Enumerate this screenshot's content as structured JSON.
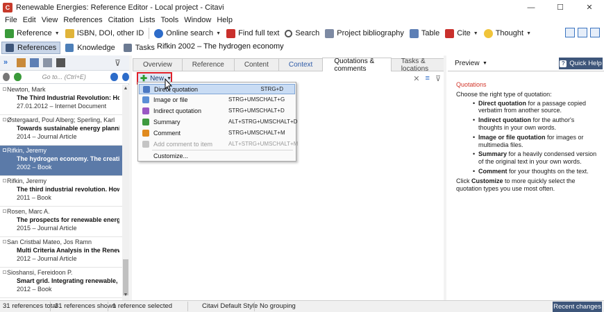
{
  "window": {
    "title": "Renewable Energies: Reference Editor - Local project - Citavi",
    "controls": [
      "—",
      "☐",
      "✕"
    ]
  },
  "menu": [
    "File",
    "Edit",
    "View",
    "References",
    "Citation",
    "Lists",
    "Tools",
    "Window",
    "Help"
  ],
  "toolbar": {
    "reference": "Reference",
    "isbn": "ISBN, DOI, other ID",
    "online_search": "Online search",
    "find_full_text": "Find full text",
    "search": "Search",
    "project_bibliography": "Project bibliography",
    "table": "Table",
    "cite": "Cite",
    "thought": "Thought"
  },
  "nav_tabs": [
    "References",
    "Knowledge",
    "Tasks"
  ],
  "left_panel": {
    "search_placeholder": "Go to... (Ctrl+E)",
    "references": [
      {
        "author": "Newton, Mark",
        "title": "The Third Industrial Revolution: How Lat",
        "meta": "27.01.2012 – Internet Document",
        "selected": false
      },
      {
        "author": "Østergaard, Poul Alberg; Sperling, Karl",
        "title": "Towards sustainable energy planning and",
        "meta": "2014 – Journal Article",
        "selected": false
      },
      {
        "author": "Rifkin, Jeremy",
        "title": "The hydrogen economy. The creation of t",
        "meta": "2002 – Book",
        "selected": true
      },
      {
        "author": "Rifkin, Jeremy",
        "title": "The third industrial revolution. How later",
        "meta": "2011 – Book",
        "selected": false
      },
      {
        "author": "Rosen, Marc A.",
        "title": "The prospects for renewable energy thro",
        "meta": "2015 – Journal Article",
        "selected": false
      },
      {
        "author": "San Cristbal Mateo, Jos Ramn",
        "title": "Multi Criteria Analysis in the Renewable E",
        "meta": "2012 – Journal Article",
        "selected": false
      },
      {
        "author": "Sioshansi, Fereidoon P.",
        "title": "Smart grid. Integrating renewable, distri",
        "meta": "2012 – Book",
        "selected": false
      }
    ]
  },
  "center": {
    "doc_title": "Rifkin 2002 – The hydrogen economy",
    "tabs": [
      "Overview",
      "Reference",
      "Content",
      "Context",
      "Quotations & comments",
      "Tasks & locations"
    ],
    "active_tab": "Quotations & comments",
    "new_button": "New",
    "menu_items": [
      {
        "label": "Direct quotation",
        "shortcut": "STRG+D",
        "highlighted": true,
        "disabled": false,
        "icon": "direct-quotation-icon",
        "color": "#4a78c2"
      },
      {
        "label": "Image or file",
        "shortcut": "STRG+UMSCHALT+G",
        "highlighted": false,
        "disabled": false,
        "icon": "image-icon",
        "color": "#5b8fd6"
      },
      {
        "label": "Indirect quotation",
        "shortcut": "STRG+UMSCHALT+D",
        "highlighted": false,
        "disabled": false,
        "icon": "indirect-quotation-icon",
        "color": "#9a58c4"
      },
      {
        "label": "Summary",
        "shortcut": "ALT+STRG+UMSCHALT+D",
        "highlighted": false,
        "disabled": false,
        "icon": "summary-icon",
        "color": "#3f9a3f"
      },
      {
        "label": "Comment",
        "shortcut": "STRG+UMSCHALT+M",
        "highlighted": false,
        "disabled": false,
        "icon": "comment-icon",
        "color": "#e08a1e"
      },
      {
        "label": "Add comment to item",
        "shortcut": "ALT+STRG+UMSCHALT+M",
        "highlighted": false,
        "disabled": true,
        "icon": "add-comment-icon",
        "color": "#c4c4c4"
      },
      {
        "label": "Customize...",
        "shortcut": "",
        "highlighted": false,
        "disabled": false,
        "icon": "",
        "color": ""
      }
    ]
  },
  "right": {
    "preview_label": "Preview",
    "quick_help": "Quick Help",
    "help_title": "Quotations",
    "help_intro": "Choose the right type of quotation:",
    "help_items": [
      {
        "bold": "Direct quotation",
        "text": " for a passage copied verbatim from another source."
      },
      {
        "bold": "Indirect quotation",
        "text": " for the author's thoughts in your own words."
      },
      {
        "bold": "Image or file quotation",
        "text": " for images or multimedia files."
      },
      {
        "bold": "Summary",
        "text": " for a heavily condensed version of the original text in your own words."
      },
      {
        "bold": "Comment",
        "text": " for your thoughts on the text."
      }
    ],
    "help_footer_pre": "Click ",
    "help_footer_bold": "Customize",
    "help_footer_post": " to more quickly select the quotation types you use most often."
  },
  "status": {
    "total": "31 references total",
    "shown": "31 references shown",
    "selected": "1 reference selected",
    "style": "Citavi Default Style",
    "grouping": "No grouping",
    "recent": "Recent changes"
  },
  "colors": {
    "accent": "#3e567a",
    "selection": "#5b7aa8",
    "highlight_border": "#e0212a",
    "help_title": "#d2352a"
  }
}
